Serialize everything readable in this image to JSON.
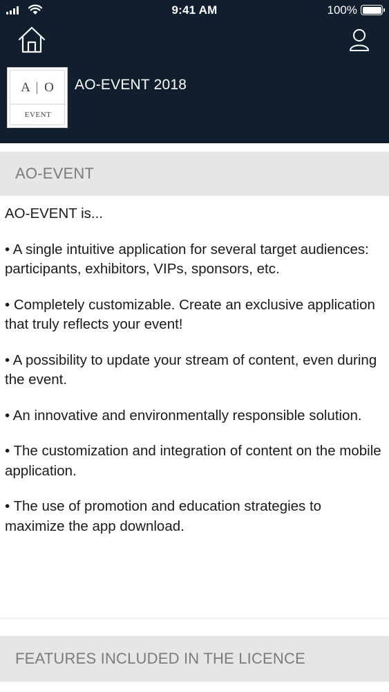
{
  "status_bar": {
    "time": "9:41 AM",
    "battery_percent": "100%",
    "battery_level": 1.0
  },
  "nav": {
    "home_icon": "home-icon",
    "profile_icon": "user-icon"
  },
  "event": {
    "logo": {
      "monogram_left": "A",
      "monogram_right": "O",
      "word": "EVENT"
    },
    "title": "AO-EVENT 2018"
  },
  "sections": [
    {
      "header": "AO-EVENT",
      "intro": "AO-EVENT is...",
      "bullets": [
        "• A single intuitive application for several target audiences: participants, exhibitors, VIPs, sponsors, etc.",
        "• Completely customizable. Create an exclusive application that truly reflects your event!",
        "• A possibility to update your stream of content, even during the event.",
        "• An innovative and environmentally responsible solution.",
        "• The customization and integration of content on the mobile application.",
        "• The use of promotion and education strategies to maximize the app download."
      ]
    },
    {
      "header": "FEATURES INCLUDED IN THE LICENCE"
    }
  ],
  "colors": {
    "header_bg": "#101e2e",
    "section_header_bg": "#e6e6e6",
    "section_header_text": "#7b7b7b"
  }
}
